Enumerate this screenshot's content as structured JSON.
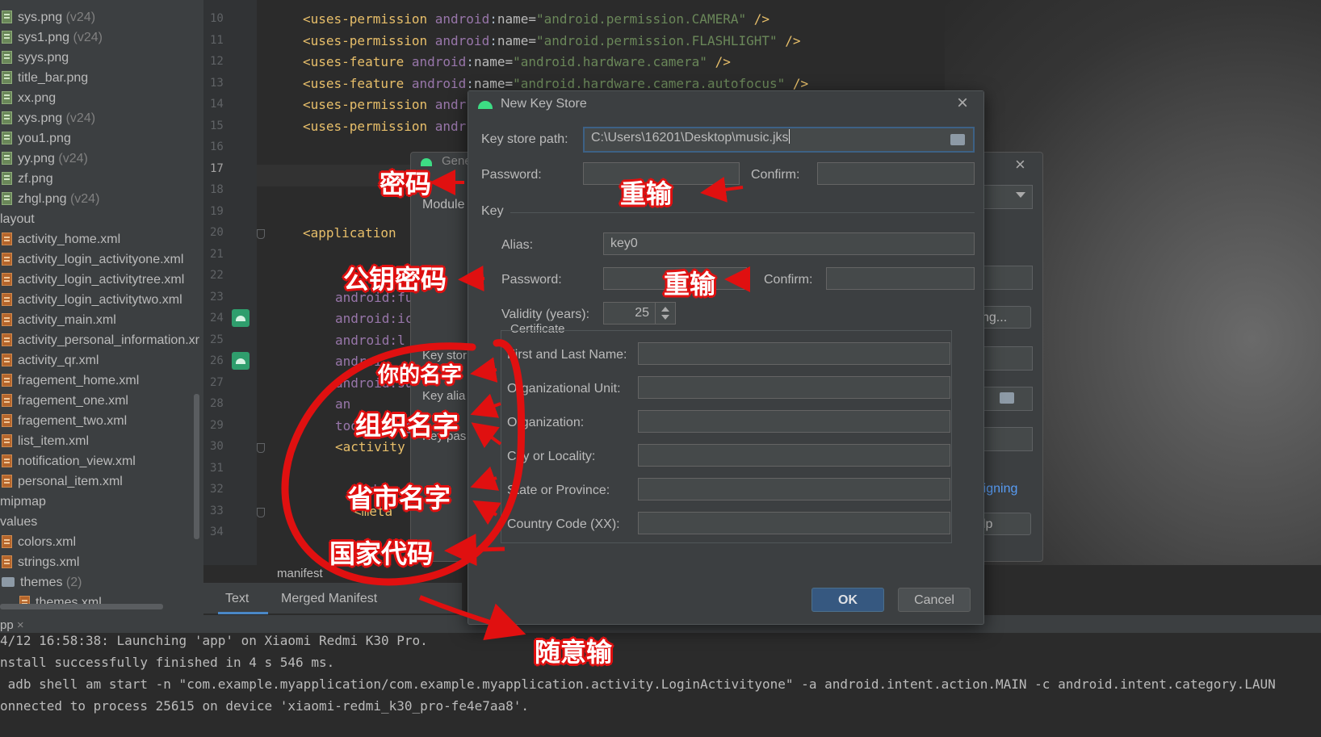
{
  "project_tree": {
    "items": [
      {
        "name": "sys.png",
        "qualifier": "(v24)",
        "type": "png"
      },
      {
        "name": "sys1.png",
        "qualifier": "(v24)",
        "type": "png"
      },
      {
        "name": "syys.png",
        "qualifier": "",
        "type": "png"
      },
      {
        "name": "title_bar.png",
        "qualifier": "",
        "type": "png"
      },
      {
        "name": "xx.png",
        "qualifier": "",
        "type": "png"
      },
      {
        "name": "xys.png",
        "qualifier": "(v24)",
        "type": "png"
      },
      {
        "name": "you1.png",
        "qualifier": "",
        "type": "png"
      },
      {
        "name": "yy.png",
        "qualifier": "(v24)",
        "type": "png"
      },
      {
        "name": "zf.png",
        "qualifier": "",
        "type": "png"
      },
      {
        "name": "zhgl.png",
        "qualifier": "(v24)",
        "type": "png"
      },
      {
        "name": "layout",
        "qualifier": "",
        "type": "dir"
      },
      {
        "name": "activity_home.xml",
        "qualifier": "",
        "type": "xml"
      },
      {
        "name": "activity_login_activityone.xml",
        "qualifier": "",
        "type": "xml"
      },
      {
        "name": "activity_login_activitytree.xml",
        "qualifier": "",
        "type": "xml"
      },
      {
        "name": "activity_login_activitytwo.xml",
        "qualifier": "",
        "type": "xml"
      },
      {
        "name": "activity_main.xml",
        "qualifier": "",
        "type": "xml"
      },
      {
        "name": "activity_personal_information.xr",
        "qualifier": "",
        "type": "xml"
      },
      {
        "name": "activity_qr.xml",
        "qualifier": "",
        "type": "xml"
      },
      {
        "name": "fragement_home.xml",
        "qualifier": "",
        "type": "xml"
      },
      {
        "name": "fragement_one.xml",
        "qualifier": "",
        "type": "xml"
      },
      {
        "name": "fragement_two.xml",
        "qualifier": "",
        "type": "xml"
      },
      {
        "name": "list_item.xml",
        "qualifier": "",
        "type": "xml"
      },
      {
        "name": "notification_view.xml",
        "qualifier": "",
        "type": "xml"
      },
      {
        "name": "personal_item.xml",
        "qualifier": "",
        "type": "xml"
      },
      {
        "name": "mipmap",
        "qualifier": "",
        "type": "dir"
      },
      {
        "name": "values",
        "qualifier": "",
        "type": "dir"
      },
      {
        "name": "colors.xml",
        "qualifier": "",
        "type": "xml"
      },
      {
        "name": "strings.xml",
        "qualifier": "",
        "type": "xml"
      },
      {
        "name": "themes",
        "qualifier": "(2)",
        "type": "folder"
      },
      {
        "name": "themes.xml",
        "qualifier": "",
        "type": "xml-nested"
      }
    ]
  },
  "editor": {
    "line_numbers": [
      "10",
      "11",
      "12",
      "13",
      "14",
      "15",
      "16",
      "17",
      "18",
      "19",
      "20",
      "21",
      "22",
      "23",
      "24",
      "25",
      "26",
      "27",
      "28",
      "29",
      "30",
      "31",
      "32",
      "33",
      "34"
    ],
    "current_line": "17",
    "code_lines": [
      {
        "open": "<uses-permission ",
        "ns": "android",
        ":": ":",
        "attr": "name=",
        "val": "\"android.permission.CAMERA\"",
        "close": " />"
      },
      {
        "open": "<uses-permission ",
        "ns": "android",
        ":": ":",
        "attr": "name=",
        "val": "\"android.permission.FLASHLIGHT\"",
        "close": " />"
      },
      {
        "open": "<uses-feature ",
        "ns": "android",
        ":": ":",
        "attr": "name=",
        "val": "\"android.hardware.camera\"",
        "close": " />"
      },
      {
        "open": "<uses-feature ",
        "ns": "android",
        ":": ":",
        "attr": "name=",
        "val": "\"android.hardware.camera.autofocus\"",
        "close": " />"
      },
      {
        "open": "<uses-permission ",
        "ns": "andr",
        "": "",
        "attr": "",
        "val": "",
        "close": ""
      },
      {
        "open": "<uses-permission ",
        "ns": "andr",
        "": "",
        "attr": "",
        "val": "",
        "close": ""
      }
    ],
    "application_tag": "<application",
    "partial_lines": [
      "android:fu",
      "android:ic",
      "android:l",
      "androi",
      "android:su",
      "an",
      "tools:targ",
      "<activity",
      "andro",
      "<meta"
    ],
    "breadcrumb": "manifest",
    "bottom_tabs": [
      "Text",
      "Merged Manifest"
    ]
  },
  "background_dialog": {
    "title_partial": "Gene",
    "module_label_partial": "Module",
    "key_store_partial": "Key stor",
    "key_alias_partial": "Key alia",
    "key_pass_partial": "Key pas",
    "button_partial_1": "ting...",
    "link_partial": "Signing",
    "button_partial_2": "elp"
  },
  "dialog": {
    "title": "New Key Store",
    "key_store_path_label": "Key store path:",
    "key_store_path_value": "C:\\Users\\16201\\Desktop\\music.jks",
    "password_label": "Password:",
    "confirm_label": "Confirm:",
    "key_section": "Key",
    "alias_label": "Alias:",
    "alias_value": "key0",
    "key_password_label": "Password:",
    "key_confirm_label": "Confirm:",
    "validity_label": "Validity (years):",
    "validity_value": "25",
    "certificate_section": "Certificate",
    "first_last_name_label": "First and Last Name:",
    "org_unit_label": "Organizational Unit:",
    "organization_label": "Organization:",
    "city_label": "City or Locality:",
    "state_label": "State or Province:",
    "country_label": "Country Code (XX):",
    "ok_label": "OK",
    "cancel_label": "Cancel"
  },
  "run_panel": {
    "tab_label": "pp",
    "lines": [
      "4/12 16:58:38: Launching 'app' on Xiaomi Redmi K30 Pro.",
      "nstall successfully finished in 4 s 546 ms.",
      " adb shell am start -n \"com.example.myapplication/com.example.myapplication.activity.LoginActivityone\" -a android.intent.action.MAIN -c android.intent.category.LAUN",
      "onnected to process 25615 on device 'xiaomi-redmi_k30_pro-fe4e7aa8'."
    ]
  },
  "annotations": {
    "mima": "密码",
    "chongshu_1": "重输",
    "gongyao_mima": "公钥密码",
    "chongshu_2": "重输",
    "nide_mingzi": "你的名字",
    "zuzhi_mingzi": "组织名字",
    "shengshi_mingzi": "省市名字",
    "guojia_daima": "国家代码",
    "suiyi_shu": "随意输"
  },
  "colors": {
    "accent_annotation": "#e01010",
    "button_primary": "#365880",
    "android_green": "#3ddc84"
  }
}
